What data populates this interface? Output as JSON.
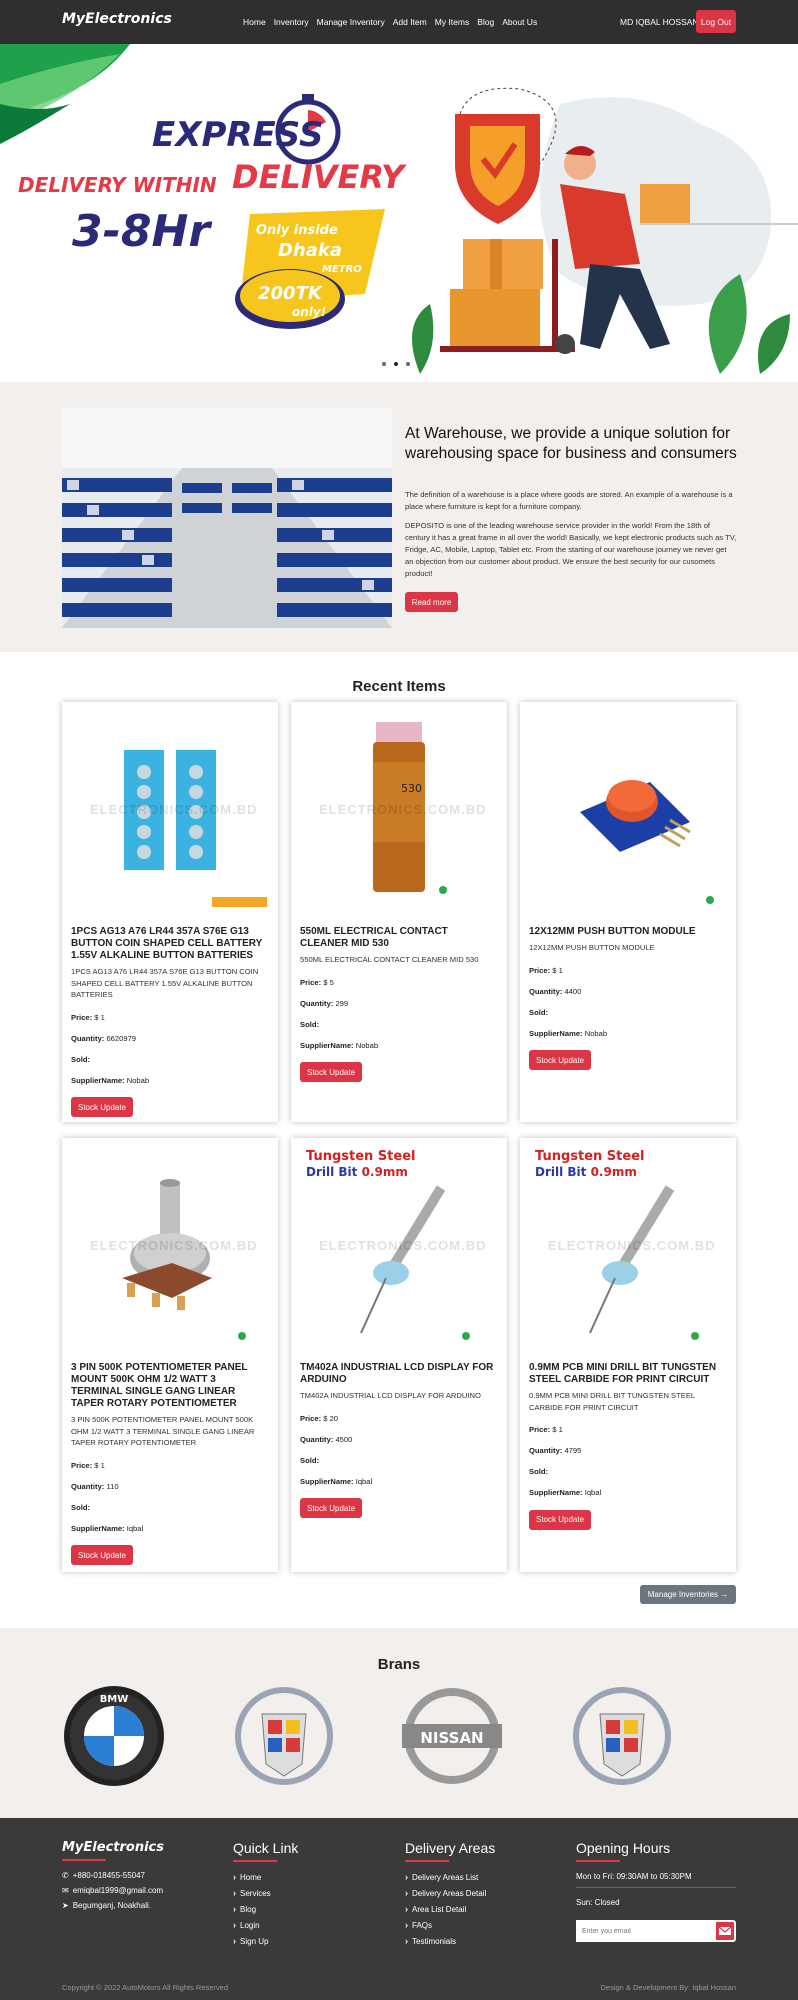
{
  "nav": {
    "brand": "MyElectronics",
    "links": [
      "Home",
      "Inventory",
      "Manage Inventory",
      "Add Item",
      "My Items",
      "Blog",
      "About Us"
    ],
    "user": "MD IQBAL HOSSAN",
    "logout": "Log Out"
  },
  "hero": {
    "line1": "EXPRESS",
    "line2": "DELIVERY",
    "line3": "DELIVERY WITHIN",
    "line4": "3-8Hr",
    "badge1": "Only inside",
    "badge2": "Dhaka",
    "badge3": "METRO",
    "price1": "200TK",
    "price2": "only!"
  },
  "about": {
    "title": "At Warehouse, we provide a unique solution for warehousing space for business and consumers",
    "p1": "The definition of a warehouse is a place where goods are stored. An example of a warehouse is a place where furniture is kept for a furniture company.",
    "p2": "DEPOSITO is one of the leading warehouse service provider in the world! From the 18th of century it has a great frame in all over the world! Basically, we kept electronic products such as TV, Fridge, AC, Mobile, Laptop, Tablet etc. From the starting of our warehouse journey we never get an objection from our customer about product. We ensure the best security for our cusomets product!",
    "button": "Read more"
  },
  "recent": {
    "title": "Recent Items",
    "labels": {
      "price": "Price:",
      "quantity": "Quantity:",
      "sold": "Sold:",
      "supplier": "SupplierName:",
      "button": "Stock Update"
    },
    "items": [
      {
        "name": "1PCS AG13 A76 LR44 357A S76E G13 BUTTON COIN SHAPED CELL BATTERY 1.55V ALKALINE BUTTON BATTERIES",
        "desc": "1PCS AG13 A76 LR44 357A S76E G13 BUTTON COIN SHAPED CELL BATTERY 1.55V ALKALINE BUTTON BATTERIES",
        "price": "$ 1",
        "quantity": "6620979",
        "sold": "",
        "supplier": "Nobab"
      },
      {
        "name": "550ML ELECTRICAL CONTACT CLEANER MID 530",
        "desc": "550ML ELECTRICAL CONTACT CLEANER MID 530",
        "price": "$ 5",
        "quantity": "299",
        "sold": "",
        "supplier": "Nobab"
      },
      {
        "name": "12X12MM PUSH BUTTON MODULE",
        "desc": "12X12MM PUSH BUTTON MODULE",
        "price": "$ 1",
        "quantity": "4400",
        "sold": "",
        "supplier": "Nobab"
      },
      {
        "name": "3 PIN 500K POTENTIOMETER PANEL MOUNT 500K OHM 1/2 WATT 3 TERMINAL SINGLE GANG LINEAR TAPER ROTARY POTENTIOMETER",
        "desc": "3 PIN 500K POTENTIOMETER PANEL MOUNT 500K OHM 1/2 WATT 3 TERMINAL SINGLE GANG LINEAR TAPER ROTARY POTENTIOMETER",
        "price": "$ 1",
        "quantity": "110",
        "sold": "",
        "supplier": "Iqbal"
      },
      {
        "name": "TM402A INDUSTRIAL LCD DISPLAY FOR ARDUINO",
        "desc": "TM402A INDUSTRIAL LCD DISPLAY FOR ARDUINO",
        "price": "$ 20",
        "quantity": "4500",
        "sold": "",
        "supplier": "Iqbal"
      },
      {
        "name": "0.9MM PCB MINI DRILL BIT TUNGSTEN STEEL CARBIDE FOR PRINT CIRCUIT",
        "desc": "0.9MM PCB MINI DRILL BIT TUNGSTEN STEEL CARBIDE FOR PRINT CIRCUIT",
        "price": "$ 1",
        "quantity": "4795",
        "sold": "",
        "supplier": "Iqbal"
      }
    ],
    "manage_button": "Manage Inventories →"
  },
  "brands": {
    "title": "Brans",
    "bmw": "BMW",
    "nissan": "NISSAN"
  },
  "footer": {
    "brand": "MyElectronics",
    "phone": "+880-018455-55047",
    "email": "emiqbal1999@gmail.com",
    "address": "Begumganj, Noakhali.",
    "quick_title": "Quick Link",
    "quick": [
      "Home",
      "Services",
      "Blog",
      "Login",
      "Sign Up"
    ],
    "delivery_title": "Delivery Areas",
    "delivery": [
      "Delivery Areas List",
      "Delivery Areas Detail",
      "Area List Detail",
      "FAQs",
      "Testimonials"
    ],
    "hours_title": "Opening Hours",
    "hours1": "Mon to Fri: 09:30AM to 05:30PM",
    "hours2": "Sun: Closed",
    "email_placeholder": "Enter you email",
    "copyright": "Copyright © 2022 AutoMotors All Rights Reserved",
    "design": "Design & Development By: Iqbal Hossan"
  }
}
